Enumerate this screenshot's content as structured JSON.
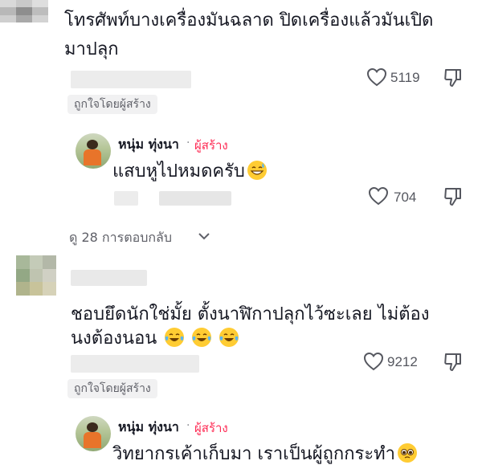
{
  "comments": [
    {
      "text_line1": "โทรศัพท์บางเครื่องมันฉลาด ปิดเครื่องแล้วมันเปิด",
      "text_line2": "มาปลุก",
      "likes": "5119",
      "liked_by_creator": "ถูกใจโดยผู้สร้าง",
      "reply": {
        "name": "หนุ่ม ทุ่งนา",
        "creator_tag": "ผู้สร้าง",
        "text": "แสบหูไปหมดครับ",
        "likes": "704"
      },
      "view_replies": "ดู 28 การตอบกลับ"
    },
    {
      "text_line1": "ชอบยึดนักใช่มั้ย ตั้งนาฬิกาปลุกไว้ซะเลย ไม่ต้อง",
      "text_line2": "นงต้องนอน",
      "likes": "9212",
      "liked_by_creator": "ถูกใจโดยผู้สร้าง",
      "reply": {
        "name": "หนุ่ม ทุ่งนา",
        "creator_tag": "ผู้สร้าง",
        "text": "วิทยากรเค้าเก็บมา เราเป็นผู้ถูกกระทำ"
      }
    }
  ],
  "separator": "·",
  "icons": {
    "like": "heart-outline-icon",
    "dislike": "thumbs-down-icon",
    "expand": "chevron-down-icon"
  },
  "colors": {
    "creator": "#fe2c55",
    "text": "#161823",
    "muted": "#5f6068",
    "emoji": "#ffcc33"
  }
}
